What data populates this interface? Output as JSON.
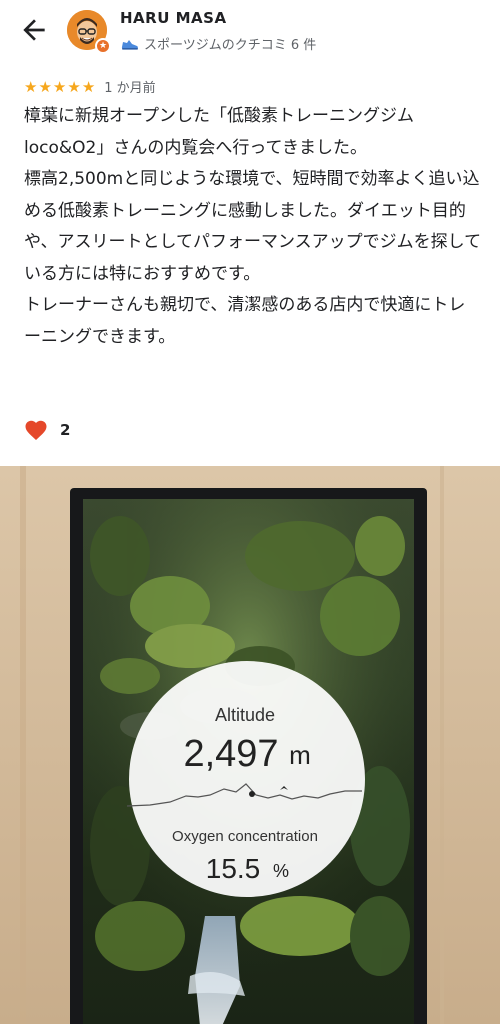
{
  "header": {
    "user_name": "HARU MASA",
    "user_subtitle": "スポーツジムのクチコミ 6 件"
  },
  "review": {
    "stars": 5,
    "time": "1 か月前",
    "paragraphs": [
      "樟葉に新規オープンした「低酸素トレーニングジム loco&O2」さんの内覧会へ行ってきました。",
      "標高2,500mと同じような環境で、短時間で効率よく追い込める低酸素トレーニングに感動しました。ダイエット目的や、アスリートとしてパフォーマンスアップでジムを探している方には特におすすめです。",
      "トレーナーさんも親切で、清潔感のある店内で快適にトレーニングできます。"
    ]
  },
  "likes": {
    "count": "2"
  },
  "photo": {
    "display": {
      "altitude_label": "Altitude",
      "altitude_value": "2,497",
      "altitude_unit": "m",
      "oxygen_label": "Oxygen concentration",
      "oxygen_value": "15.5",
      "oxygen_unit": "%"
    }
  },
  "colors": {
    "star": "#f6a71d",
    "heart": "#e5482a",
    "avatar_bg": "#e8892a"
  }
}
